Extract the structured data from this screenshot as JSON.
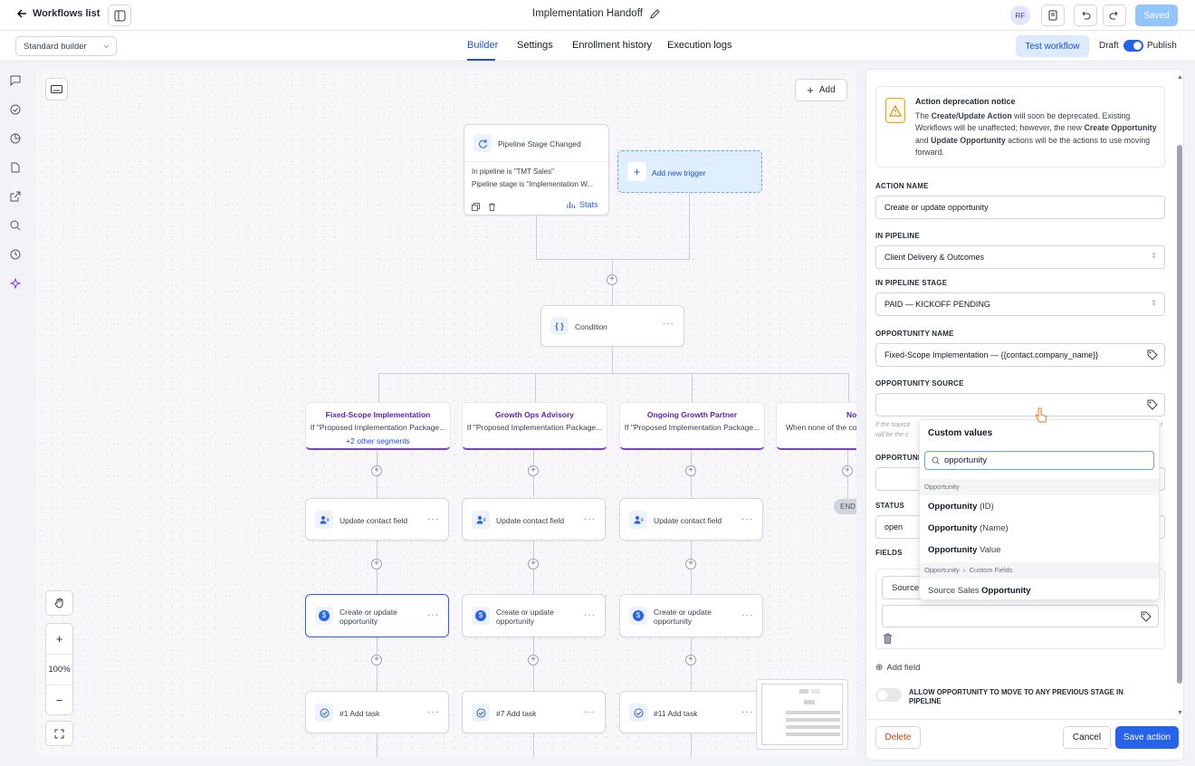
{
  "header": {
    "back_label": "Workflows list",
    "title": "Implementation Handoff",
    "avatar_initials": "RF",
    "saved_label": "Saved"
  },
  "subheader": {
    "builder_select": "Standard builder",
    "tabs": [
      {
        "label": "Builder",
        "active": true
      },
      {
        "label": "Settings",
        "active": false
      },
      {
        "label": "Enrollment history",
        "active": false
      },
      {
        "label": "Execution logs",
        "active": false
      }
    ],
    "test_label": "Test workflow",
    "draft_label": "Draft",
    "publish_label": "Publish"
  },
  "canvas": {
    "add_label": "Add",
    "zoom": "100%",
    "trigger": {
      "title": "Pipeline Stage Changed",
      "line1": "In pipeline is \"TMT Sales\"",
      "line2": "Pipeline stage is \"Implementation W...",
      "stats_label": "Stats"
    },
    "add_trigger_label": "Add new trigger",
    "condition_label": "Condition",
    "branches": [
      {
        "title": "Fixed-Scope Implementation",
        "sub": "If \"Proposed Implementation Package...",
        "extra": "+2 other segments"
      },
      {
        "title": "Growth Ops Advisory",
        "sub": "If \"Proposed Implementation Package...",
        "extra": ""
      },
      {
        "title": "Ongoing Growth Partner",
        "sub": "If \"Proposed Implementation Package...",
        "extra": ""
      },
      {
        "title": "No",
        "sub": "When none of the co",
        "extra": ""
      }
    ],
    "update_contact_label": "Update contact field",
    "create_opp_line1": "Create or update",
    "create_opp_line2": "opportunity",
    "tasks": [
      "#1 Add task",
      "#7 Add task",
      "#11 Add task"
    ],
    "end_label": "END"
  },
  "panel": {
    "notice_title": "Action deprecation notice",
    "notice_text_1": "The ",
    "notice_bold_1": "Create/Update Action",
    "notice_text_2": " will soon be deprecated. Existing Workflows will be unaffected; however, the new ",
    "notice_bold_2": "Create Opportunity",
    "notice_text_3": " and ",
    "notice_bold_3": "Update Opportunity",
    "notice_text_4": " actions will be the actions to use moving forward.",
    "action_name_label": "ACTION NAME",
    "action_name_value": "Create or update opportunity",
    "pipeline_label": "IN PIPELINE",
    "pipeline_value": "Client Delivery & Outcomes",
    "stage_label": "IN PIPELINE STAGE",
    "stage_value": "PAID — KICKOFF PENDING",
    "opp_name_label": "OPPORTUNITY NAME",
    "opp_name_value": "Fixed-Scope Implementation — {{contact.company_name}}",
    "opp_source_label": "OPPORTUNITY SOURCE",
    "opp_source_value": "",
    "hint_1": "If the source",
    "hint_2": "will be the c",
    "hint_3": "t",
    "opp_value_label": "OPPORTUNI",
    "status_label": "STATUS",
    "status_value": "open",
    "fields_label": "FIELDS",
    "field_source": "Source",
    "add_field_label": "Add field",
    "allow_label": "ALLOW OPPORTUNITY TO MOVE TO ANY PREVIOUS STAGE IN PIPELINE",
    "delete_label": "Delete",
    "cancel_label": "Cancel",
    "save_label": "Save action"
  },
  "dropdown": {
    "header": "Custom values",
    "search_value": "opportunity",
    "group1": "Opportunity",
    "items": [
      {
        "bold": "Opportunity",
        "rest": " (ID)"
      },
      {
        "bold": "Opportunity",
        "rest": " (Name)"
      },
      {
        "bold": "Opportunity",
        "rest": " Value"
      }
    ],
    "group2_a": "Opportunity",
    "group2_b": "Custom Fields",
    "item4_pre": "Source Sales ",
    "item4_bold": "Opportunity"
  },
  "colors": {
    "accent": "#2563eb",
    "branch": "#7c3aed",
    "delete": "#c2410c"
  }
}
